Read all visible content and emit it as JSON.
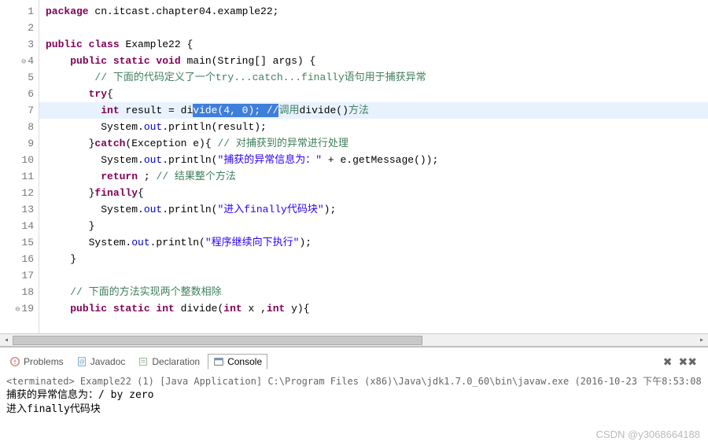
{
  "code": {
    "lines": [
      {
        "n": 1,
        "marker": "",
        "html": "<span class='kw'>package</span> <span class='plain'>cn.itcast.chapter04.example22;</span>"
      },
      {
        "n": 2,
        "marker": "",
        "html": ""
      },
      {
        "n": 3,
        "marker": "",
        "html": "<span class='kw'>public class</span> <span class='plain'>Example22 {</span>"
      },
      {
        "n": 4,
        "marker": "⊖",
        "html": "    <span class='kw'>public static void</span> <span class='plain'>main(String[] args) {</span>"
      },
      {
        "n": 5,
        "marker": "",
        "html": "        <span class='cmt'>// 下面的代码定义了一个try...catch...finally语句用于捕获异常</span>"
      },
      {
        "n": 6,
        "marker": "",
        "html": "       <span class='kw'>try</span><span class='plain'>{</span>"
      },
      {
        "n": 7,
        "marker": "",
        "current": true,
        "html": "         <span class='kw'>int</span> <span class='plain'>result = di</span><span class='selection'>vide(4, 0); //</span><span class='cmt'>调用</span><span class='plain'>divide()</span><span class='cmt'>方法</span>"
      },
      {
        "n": 8,
        "marker": "",
        "html": "         <span class='plain'>System.</span><span class='field'>out</span><span class='plain'>.println(result);</span>"
      },
      {
        "n": 9,
        "marker": "",
        "html": "       <span class='plain'>}</span><span class='kw'>catch</span><span class='plain'>(Exception e){ </span><span class='cmt'>// 对捕获到的异常进行处理</span>"
      },
      {
        "n": 10,
        "marker": "",
        "html": "         <span class='plain'>System.</span><span class='field'>out</span><span class='plain'>.println(</span><span class='str'>\"捕获的异常信息为：\"</span><span class='plain'> + e.getMessage());</span>"
      },
      {
        "n": 11,
        "marker": "",
        "html": "         <span class='kw'>return</span> <span class='plain'>; </span><span class='cmt'>// 结果整个方法</span>"
      },
      {
        "n": 12,
        "marker": "",
        "html": "       <span class='plain'>}</span><span class='kw'>finally</span><span class='plain'>{</span>"
      },
      {
        "n": 13,
        "marker": "",
        "html": "         <span class='plain'>System.</span><span class='field'>out</span><span class='plain'>.println(</span><span class='str'>\"进入finally代码块\"</span><span class='plain'>);</span>"
      },
      {
        "n": 14,
        "marker": "",
        "html": "       <span class='plain'>}</span>"
      },
      {
        "n": 15,
        "marker": "",
        "html": "       <span class='plain'>System.</span><span class='field'>out</span><span class='plain'>.println(</span><span class='str'>\"程序继续向下执行\"</span><span class='plain'>);</span>"
      },
      {
        "n": 16,
        "marker": "",
        "html": "    <span class='plain'>}</span>"
      },
      {
        "n": 17,
        "marker": "",
        "html": ""
      },
      {
        "n": 18,
        "marker": "",
        "html": "    <span class='cmt'>// 下面的方法实现两个整数相除</span>"
      },
      {
        "n": 19,
        "marker": "⊖",
        "html": "    <span class='kw'>public static int</span> <span class='plain'>divide(</span><span class='kw'>int</span><span class='plain'> x ,</span><span class='kw'>int</span><span class='plain'> y){</span>"
      }
    ]
  },
  "tabs": {
    "problems": "Problems",
    "javadoc": "Javadoc",
    "declaration": "Declaration",
    "console": "Console"
  },
  "console": {
    "header": "<terminated> Example22 (1) [Java Application] C:\\Program Files (x86)\\Java\\jdk1.7.0_60\\bin\\javaw.exe (2016-10-23 下午8:53:08",
    "line1": "捕获的异常信息为：/ by zero",
    "line2": "进入finally代码块"
  },
  "watermark": "CSDN @y3068664188"
}
